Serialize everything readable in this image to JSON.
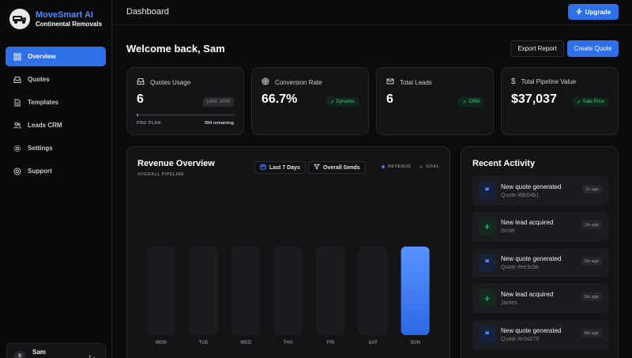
{
  "brand": {
    "name": "MoveSmart AI",
    "subtitle": "Continental Removals",
    "logo": "moving-truck-logo"
  },
  "sidebar": {
    "items": [
      {
        "label": "Overview",
        "icon": "grid-icon",
        "active": true
      },
      {
        "label": "Quotes",
        "icon": "inbox-icon",
        "active": false
      },
      {
        "label": "Templates",
        "icon": "document-icon",
        "active": false
      },
      {
        "label": "Leads CRM",
        "icon": "users-icon",
        "active": false
      },
      {
        "label": "Settings",
        "icon": "gear-icon",
        "active": false
      },
      {
        "label": "Support",
        "icon": "lifebuoy-icon",
        "active": false
      }
    ],
    "user": {
      "initial": "S",
      "name": "Sam"
    }
  },
  "header": {
    "title": "Dashboard",
    "upgrade_label": "Upgrade"
  },
  "welcome": {
    "text": "Welcome back, Sam",
    "export_label": "Export Report",
    "create_label": "Create Quote"
  },
  "stats": [
    {
      "label": "Quotes Usage",
      "icon": "inbox-icon",
      "value": "6",
      "badge": "Limit: 1000",
      "plan": "PRO PLAN",
      "remaining": "994 remaining",
      "progress_fraction": 0.006
    },
    {
      "label": "Conversion Rate",
      "icon": "target-icon",
      "value": "66.7%",
      "badge": "Dynamic"
    },
    {
      "label": "Total Leads",
      "icon": "mail-icon",
      "value": "6",
      "badge": "CRM"
    },
    {
      "label": "Total Pipeline Value",
      "icon": "dollar-icon",
      "value": "$37,037",
      "badge": "Sale Price"
    }
  ],
  "revenue": {
    "title": "Revenue Overview",
    "subtitle": "OVERALL PIPELINE",
    "range_label": "Last 7 Days",
    "filter_label": "Overall Sends",
    "legend_revenue": "REVENUE",
    "legend_goal": "GOAL"
  },
  "chart_data": {
    "type": "bar",
    "categories": [
      "MON",
      "TUE",
      "WED",
      "THU",
      "FRI",
      "SAT",
      "SUN"
    ],
    "series": [
      {
        "name": "REVENUE",
        "values": [
          0,
          0,
          0,
          0,
          0,
          0,
          37037
        ]
      }
    ],
    "colors": {
      "revenue": "#3b7cf6",
      "goal": "#1c1c20"
    },
    "grid": false
  },
  "activity": {
    "title": "Recent Activity",
    "items": [
      {
        "type": "quote",
        "icon": "quote-icon",
        "title": "New quote generated",
        "sub": "Quote #8b54b1",
        "time": "1h ago"
      },
      {
        "type": "lead",
        "icon": "plus-icon",
        "title": "New lead acquired",
        "sub": "Smith",
        "time": "1m ago"
      },
      {
        "type": "quote",
        "icon": "quote-icon",
        "title": "New quote generated",
        "sub": "Quote #ee3cbb",
        "time": "3m ago"
      },
      {
        "type": "lead",
        "icon": "plus-icon",
        "title": "New lead acquired",
        "sub": "James",
        "time": "3m ago"
      },
      {
        "type": "quote",
        "icon": "quote-icon",
        "title": "New quote generated",
        "sub": "Quote #e3d275",
        "time": "8m ago"
      }
    ]
  },
  "colors": {
    "accent": "#2f6fe8",
    "positive": "#3ecf80",
    "brand_text": "#4f8cff"
  }
}
